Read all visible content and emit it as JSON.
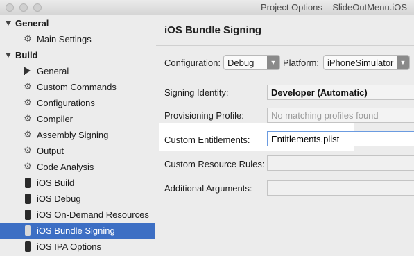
{
  "window": {
    "title": "Project Options – SlideOutMenu.iOS"
  },
  "sidebar": {
    "groups": [
      {
        "label": "General",
        "items": [
          {
            "label": "Main Settings",
            "icon": "gear-icon"
          }
        ]
      },
      {
        "label": "Build",
        "items": [
          {
            "label": "General",
            "icon": "play-icon"
          },
          {
            "label": "Custom Commands",
            "icon": "gear-icon"
          },
          {
            "label": "Configurations",
            "icon": "gear-icon"
          },
          {
            "label": "Compiler",
            "icon": "gear-icon"
          },
          {
            "label": "Assembly Signing",
            "icon": "gear-icon"
          },
          {
            "label": "Output",
            "icon": "gear-icon"
          },
          {
            "label": "Code Analysis",
            "icon": "gear-icon"
          },
          {
            "label": "iOS Build",
            "icon": "phone-icon"
          },
          {
            "label": "iOS Debug",
            "icon": "phone-icon"
          },
          {
            "label": "iOS On-Demand Resources",
            "icon": "phone-icon"
          },
          {
            "label": "iOS Bundle Signing",
            "icon": "phone-icon",
            "selected": true
          },
          {
            "label": "iOS IPA Options",
            "icon": "phone-icon"
          }
        ]
      }
    ]
  },
  "main": {
    "heading": "iOS Bundle Signing",
    "configuration": {
      "label": "Configuration:",
      "value": "Debug"
    },
    "platform": {
      "label": "Platform:",
      "value": "iPhoneSimulator"
    },
    "fields": {
      "signing_identity": {
        "label": "Signing Identity:",
        "value": "Developer (Automatic)"
      },
      "provisioning_profile": {
        "label": "Provisioning Profile:",
        "value": "No matching profiles found"
      },
      "custom_entitlements": {
        "label": "Custom Entitlements:",
        "value": "Entitlements.plist"
      },
      "custom_resource_rules": {
        "label": "Custom Resource Rules:",
        "value": ""
      },
      "additional_arguments": {
        "label": "Additional Arguments:",
        "value": ""
      }
    }
  },
  "colors": {
    "selection": "#3d6fc4",
    "focus_ring": "#6b9be0"
  }
}
